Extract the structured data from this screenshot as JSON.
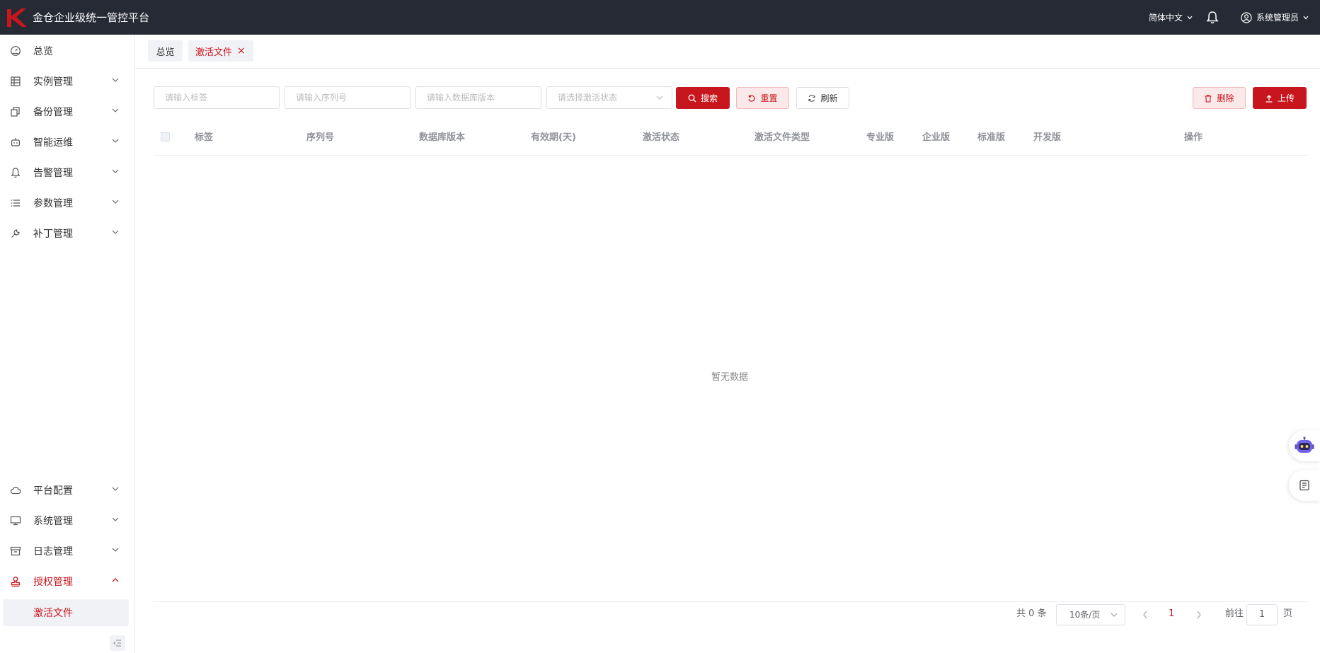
{
  "header": {
    "app_title": "金仓企业级统一管控平台",
    "language": "简体中文",
    "user": "系统管理员",
    "brand_color": "#c8161e",
    "bar_color": "#262a34"
  },
  "sidebar": {
    "items": [
      {
        "label": "总览",
        "icon": "dashboard-icon"
      },
      {
        "label": "实例管理",
        "icon": "database-icon"
      },
      {
        "label": "备份管理",
        "icon": "copy-icon"
      },
      {
        "label": "智能运维",
        "icon": "robot-icon"
      },
      {
        "label": "告警管理",
        "icon": "bell-icon"
      },
      {
        "label": "参数管理",
        "icon": "list-icon"
      },
      {
        "label": "补丁管理",
        "icon": "wrench-icon"
      },
      {
        "label": "平台配置",
        "icon": "cloud-icon"
      },
      {
        "label": "系统管理",
        "icon": "monitor-icon"
      },
      {
        "label": "日志管理",
        "icon": "archive-icon"
      },
      {
        "label": "授权管理",
        "icon": "stamp-icon"
      }
    ],
    "sub_item": "激活文件"
  },
  "tabs": {
    "home": "总览",
    "active": "激活文件",
    "close": "×"
  },
  "filters": {
    "tag_placeholder": "请输入标签",
    "serial_placeholder": "请输入序列号",
    "db_version_placeholder": "请输入数据库版本",
    "status_placeholder": "请选择激活状态"
  },
  "buttons": {
    "search": "搜索",
    "reset": "重置",
    "refresh": "刷新",
    "delete": "删除",
    "upload": "上传"
  },
  "table": {
    "columns": [
      "标签",
      "序列号",
      "数据库版本",
      "有效期(天)",
      "激活状态",
      "激活文件类型",
      "专业版",
      "企业版",
      "标准版",
      "开发版",
      "操作"
    ],
    "empty_text": "暂无数据"
  },
  "pagination": {
    "total": "共 0 条",
    "page_size": "10条/页",
    "current_page": "1",
    "goto_label": "前往",
    "goto_value": "1",
    "page_suffix": "页"
  }
}
